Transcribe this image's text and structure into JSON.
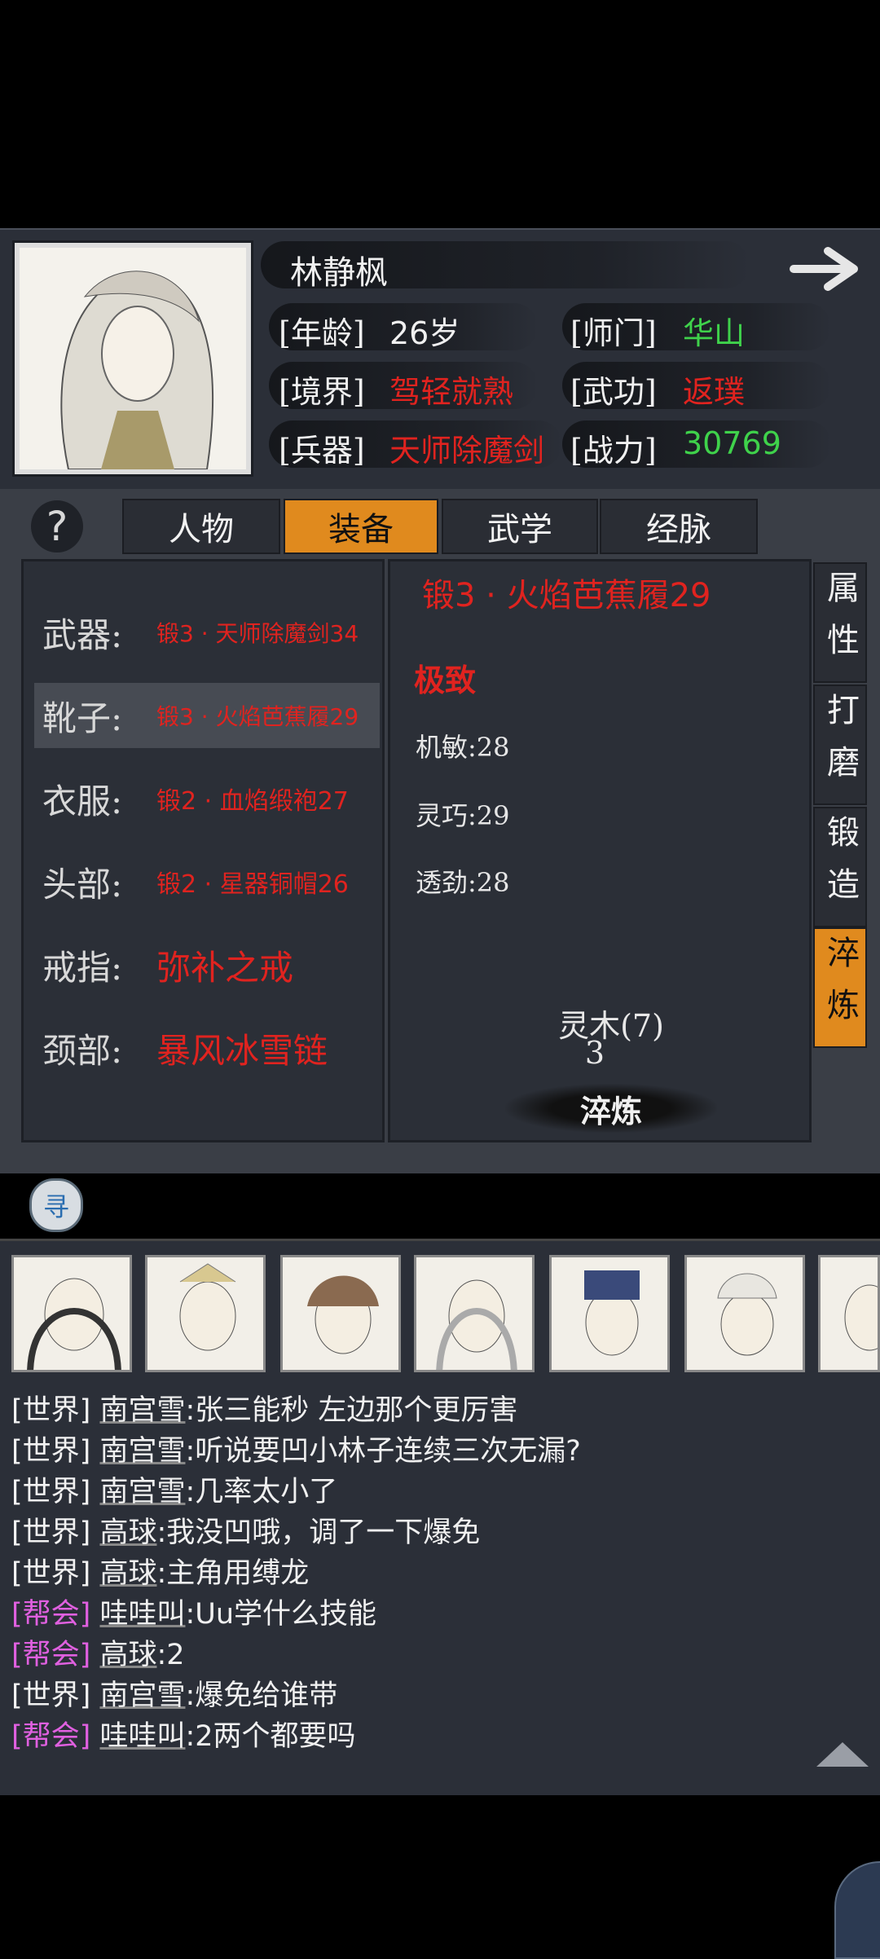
{
  "character": {
    "name": "林静枫",
    "age_label": "[年龄]",
    "age": "26岁",
    "school_label": "[师门]",
    "school": "华山",
    "realm_label": "[境界]",
    "realm": "驾轻就熟",
    "martial_label": "[武功]",
    "martial": "返璞",
    "weapon_label": "[兵器]",
    "weapon": "天师除魔剑",
    "power_label": "[战力]",
    "power": "30769"
  },
  "help_icon": "?",
  "tabs": [
    "人物",
    "装备",
    "武学",
    "经脉"
  ],
  "equipment": [
    {
      "slot": "武器:",
      "item": "锻3 · 天师除魔剑34"
    },
    {
      "slot": "靴子:",
      "item": "锻3 · 火焰芭蕉履29"
    },
    {
      "slot": "衣服:",
      "item": "锻2 · 血焰缎袍27"
    },
    {
      "slot": "头部:",
      "item": "锻2 · 星器铜帽26"
    },
    {
      "slot": "戒指:",
      "item": "弥补之戒"
    },
    {
      "slot": "颈部:",
      "item": "暴风冰雪链"
    }
  ],
  "detail": {
    "title": "锻3 · 火焰芭蕉履29",
    "grade": "极致",
    "stats": [
      "机敏:28",
      "灵巧:29",
      "透劲:28"
    ],
    "material": "灵木(7)",
    "material_count": "3",
    "action": "淬炼"
  },
  "side_tabs": [
    "属性",
    "打磨",
    "锻造",
    "淬炼"
  ],
  "search_icon_text": "寻",
  "chat": [
    {
      "channel": "[世界]",
      "speaker": "南宫雪",
      "text": ":张三能秒 左边那个更厉害",
      "type": "world"
    },
    {
      "channel": "[世界]",
      "speaker": "南宫雪",
      "text": ":听说要凹小林子连续三次无漏?",
      "type": "world"
    },
    {
      "channel": "[世界]",
      "speaker": "南宫雪",
      "text": ":几率太小了",
      "type": "world"
    },
    {
      "channel": "[世界]",
      "speaker": "高球",
      "text": ":我没凹哦，调了一下爆免",
      "type": "world"
    },
    {
      "channel": "[世界]",
      "speaker": "高球",
      "text": ":主角用缚龙",
      "type": "world"
    },
    {
      "channel": "[帮会]",
      "speaker": "哇哇叫",
      "text": ":Uu学什么技能",
      "type": "guild"
    },
    {
      "channel": "[帮会]",
      "speaker": "高球",
      "text": ":2",
      "type": "guild"
    },
    {
      "channel": "[世界]",
      "speaker": "南宫雪",
      "text": ":爆免给谁带",
      "type": "world"
    },
    {
      "channel": "[帮会]",
      "speaker": "哇哇叫",
      "text": ":2两个都要吗",
      "type": "guild"
    }
  ],
  "colors": {
    "accent": "#e08a1e",
    "red": "#e0231f",
    "green": "#3fd24b",
    "guild": "#e060e0"
  }
}
